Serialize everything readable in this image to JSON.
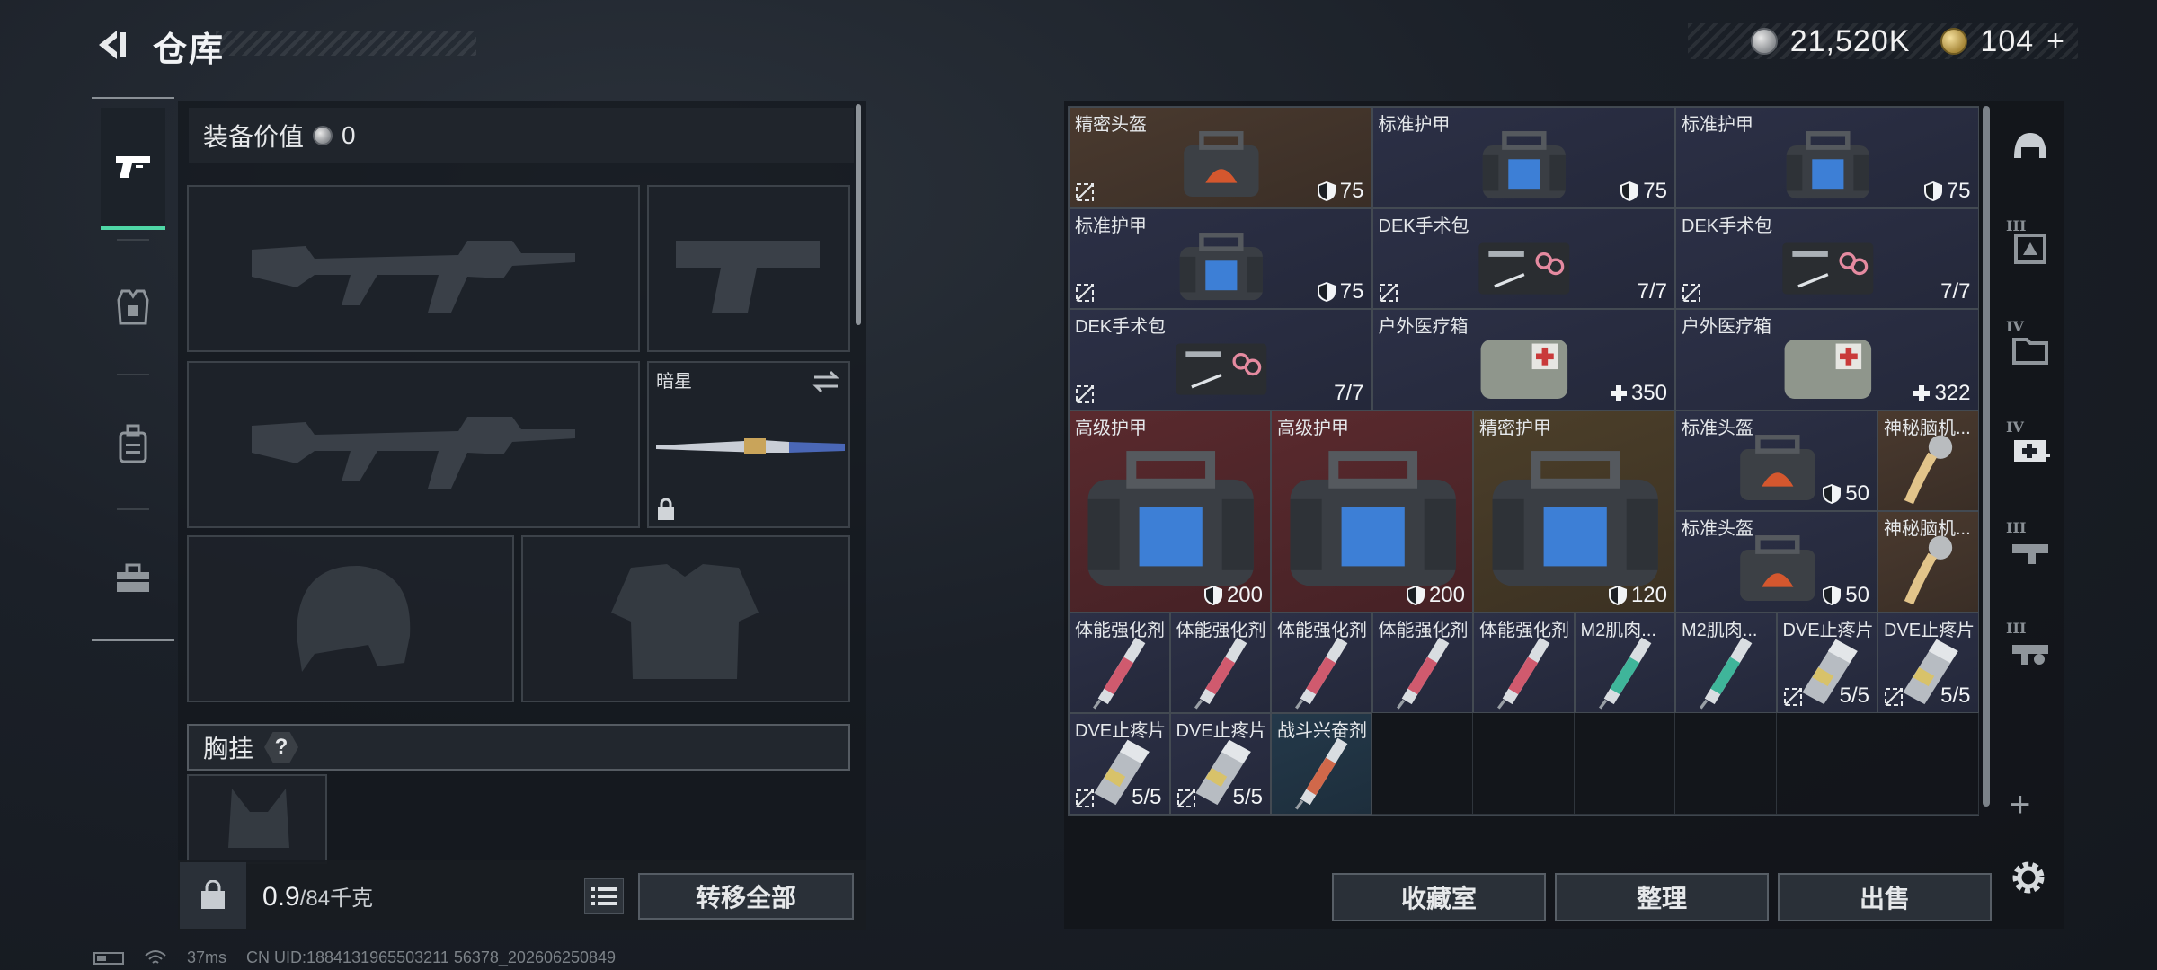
{
  "header": {
    "title": "仓库",
    "currency_silver": "21,520K",
    "currency_gold": "104",
    "gold_add": "+"
  },
  "left_tabs": [
    {
      "id": "weapons",
      "icon": "pistol-icon",
      "active": true
    },
    {
      "id": "gear",
      "icon": "armor-vest-icon",
      "active": false
    },
    {
      "id": "backpack",
      "icon": "backpack-icon",
      "active": false
    },
    {
      "id": "toolkit",
      "icon": "toolbox-icon",
      "active": false
    }
  ],
  "equipment": {
    "value_label": "装备价值",
    "value": "0",
    "knife_name": "暗星",
    "rig_label": "胸挂",
    "rig_help": "?"
  },
  "footer": {
    "weight_current": "0.9",
    "weight_max": "/84千克",
    "transfer_all": "转移全部"
  },
  "storage_items": [
    {
      "name": "精密头盔",
      "value": "75",
      "value_icon": "shield",
      "rarity": "brown",
      "no_sell": true
    },
    {
      "name": "标准护甲",
      "value": "75",
      "value_icon": "shield",
      "rarity": "blue",
      "no_sell": false
    },
    {
      "name": "标准护甲",
      "value": "75",
      "value_icon": "shield",
      "rarity": "blue",
      "no_sell": false
    },
    {
      "name": "标准护甲",
      "value": "75",
      "value_icon": "shield",
      "rarity": "blue",
      "no_sell": true
    },
    {
      "name": "DEK手术包",
      "value": "7/7",
      "value_icon": "",
      "rarity": "blue",
      "no_sell": true
    },
    {
      "name": "DEK手术包",
      "value": "7/7",
      "value_icon": "",
      "rarity": "blue",
      "no_sell": true
    },
    {
      "name": "DEK手术包",
      "value": "7/7",
      "value_icon": "",
      "rarity": "blue",
      "no_sell": true
    },
    {
      "name": "户外医疗箱",
      "value": "350",
      "value_icon": "plus",
      "rarity": "blue",
      "no_sell": false
    },
    {
      "name": "户外医疗箱",
      "value": "322",
      "value_icon": "plus",
      "rarity": "blue",
      "no_sell": false
    },
    {
      "name": "高级护甲",
      "value": "200",
      "value_icon": "shield",
      "rarity": "red",
      "no_sell": false
    },
    {
      "name": "高级护甲",
      "value": "200",
      "value_icon": "shield",
      "rarity": "red",
      "no_sell": false
    },
    {
      "name": "精密护甲",
      "value": "120",
      "value_icon": "shield",
      "rarity": "gold",
      "no_sell": false
    },
    {
      "name": "标准头盔",
      "value": "50",
      "value_icon": "shield",
      "rarity": "blue",
      "no_sell": false
    },
    {
      "name": "神秘脑机...",
      "value": "",
      "value_icon": "",
      "rarity": "brown",
      "no_sell": false
    },
    {
      "name": "标准头盔",
      "value": "50",
      "value_icon": "shield",
      "rarity": "blue",
      "no_sell": false
    },
    {
      "name": "神秘脑机...",
      "value": "",
      "value_icon": "",
      "rarity": "brown",
      "no_sell": false
    },
    {
      "name": "体能强化剂",
      "value": "",
      "value_icon": "",
      "rarity": "blue",
      "no_sell": false
    },
    {
      "name": "体能强化剂",
      "value": "",
      "value_icon": "",
      "rarity": "blue",
      "no_sell": false
    },
    {
      "name": "体能强化剂",
      "value": "",
      "value_icon": "",
      "rarity": "blue",
      "no_sell": false
    },
    {
      "name": "体能强化剂",
      "value": "",
      "value_icon": "",
      "rarity": "blue",
      "no_sell": false
    },
    {
      "name": "体能强化剂",
      "value": "",
      "value_icon": "",
      "rarity": "blue",
      "no_sell": false
    },
    {
      "name": "M2肌肉...",
      "value": "",
      "value_icon": "",
      "rarity": "blue",
      "no_sell": false
    },
    {
      "name": "M2肌肉...",
      "value": "",
      "value_icon": "",
      "rarity": "blue",
      "no_sell": false
    },
    {
      "name": "DVE止疼片",
      "value": "5/5",
      "value_icon": "",
      "rarity": "blue",
      "no_sell": true
    },
    {
      "name": "DVE止疼片",
      "value": "5/5",
      "value_icon": "",
      "rarity": "blue",
      "no_sell": true
    },
    {
      "name": "DVE止疼片",
      "value": "5/5",
      "value_icon": "",
      "rarity": "blue",
      "no_sell": true
    },
    {
      "name": "DVE止疼片",
      "value": "5/5",
      "value_icon": "",
      "rarity": "blue",
      "no_sell": true
    },
    {
      "name": "战斗兴奋剂",
      "value": "",
      "value_icon": "",
      "rarity": "teal",
      "no_sell": false
    }
  ],
  "storage_buttons": {
    "collection": "收藏室",
    "organize": "整理",
    "sell": "出售"
  },
  "filter_rail": [
    {
      "icon": "helmet-filter-icon",
      "roman": ""
    },
    {
      "icon": "armor-filter-icon",
      "roman": "III"
    },
    {
      "icon": "folder-filter-icon",
      "roman": "IV"
    },
    {
      "icon": "medkit-filter-icon",
      "roman": "IV"
    },
    {
      "icon": "gun-filter-icon",
      "roman": "III"
    },
    {
      "icon": "gun-alt-filter-icon",
      "roman": "III"
    }
  ],
  "filter_add": "+",
  "status": {
    "ping": "37ms",
    "uid": "CN UID:1884131965503211 56378_202606250849"
  },
  "colors": {
    "accent": "#4fd7a6",
    "rarity_blue": "#2c3046",
    "rarity_red": "#5a2a2e",
    "rarity_gold": "#4c3f2a",
    "rarity_brown": "#4a3a2f"
  }
}
